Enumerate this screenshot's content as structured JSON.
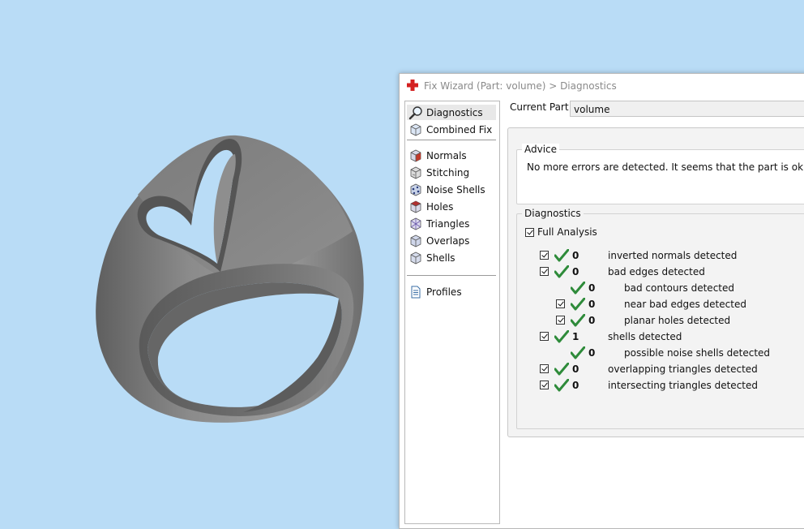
{
  "window": {
    "title": "Fix Wizard (Part: volume) > Diagnostics"
  },
  "nav": {
    "top_items": [
      {
        "label": "Diagnostics",
        "icon": "magnifier-icon",
        "selected": true
      },
      {
        "label": "Combined Fix",
        "icon": "cube-fix-icon"
      }
    ],
    "fix_items": [
      {
        "label": "Normals",
        "icon": "normals-cube-icon"
      },
      {
        "label": "Stitching",
        "icon": "stitching-cube-icon"
      },
      {
        "label": "Noise Shells",
        "icon": "noise-shells-icon"
      },
      {
        "label": "Holes",
        "icon": "holes-cube-icon"
      },
      {
        "label": "Triangles",
        "icon": "triangles-icon"
      },
      {
        "label": "Overlaps",
        "icon": "overlaps-cube-icon"
      },
      {
        "label": "Shells",
        "icon": "shells-cube-icon"
      }
    ],
    "bottom_items": [
      {
        "label": "Profiles",
        "icon": "document-icon"
      }
    ]
  },
  "current_part": {
    "label": "Current Part:",
    "value": "volume"
  },
  "advice": {
    "title": "Advice",
    "text": "No more errors are detected. It seems that the part is ok."
  },
  "diagnostics": {
    "title": "Diagnostics",
    "full_analysis_label": "Full Analysis",
    "full_analysis_checked": true,
    "rows": [
      {
        "indent": 0,
        "checkbox": true,
        "count": "0",
        "label": "inverted normals detected"
      },
      {
        "indent": 0,
        "checkbox": true,
        "count": "0",
        "label": "bad edges detected"
      },
      {
        "indent": 1,
        "checkbox": false,
        "count": "0",
        "label": "bad contours detected"
      },
      {
        "indent": 1,
        "checkbox": true,
        "count": "0",
        "label": "near bad edges detected"
      },
      {
        "indent": 1,
        "checkbox": true,
        "count": "0",
        "label": "planar holes detected"
      },
      {
        "indent": 0,
        "checkbox": true,
        "count": "1",
        "label": "shells detected"
      },
      {
        "indent": 1,
        "checkbox": false,
        "count": "0",
        "label": "possible noise shells detected"
      },
      {
        "indent": 0,
        "checkbox": true,
        "count": "0",
        "label": "overlapping triangles detected"
      },
      {
        "indent": 0,
        "checkbox": true,
        "count": "0",
        "label": "intersecting triangles detected"
      }
    ]
  },
  "colors": {
    "viewport_bg": "#b9dcf6",
    "model_gray": "#7a7a7a",
    "check_green": "#2e8b3a",
    "title_icon_red": "#d42020"
  }
}
